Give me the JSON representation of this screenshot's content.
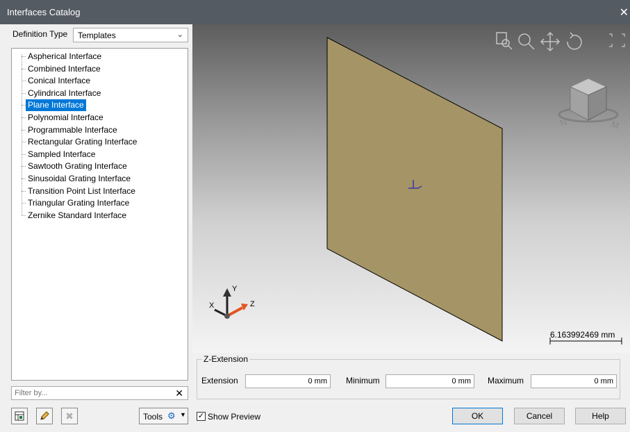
{
  "window": {
    "title": "Interfaces Catalog",
    "close_glyph": "✕"
  },
  "definition_type": {
    "label": "Definition Type",
    "value": "Templates"
  },
  "tree": {
    "items": [
      {
        "label": "Aspherical Interface"
      },
      {
        "label": "Combined Interface"
      },
      {
        "label": "Conical Interface"
      },
      {
        "label": "Cylindrical Interface"
      },
      {
        "label": "Plane Interface",
        "selected": true
      },
      {
        "label": "Polynomial Interface"
      },
      {
        "label": "Programmable Interface"
      },
      {
        "label": "Rectangular Grating Interface"
      },
      {
        "label": "Sampled Interface"
      },
      {
        "label": "Sawtooth Grating Interface"
      },
      {
        "label": "Sinusoidal Grating Interface"
      },
      {
        "label": "Transition Point List Interface"
      },
      {
        "label": "Triangular Grating Interface"
      },
      {
        "label": "Zernike Standard Interface"
      }
    ]
  },
  "filter": {
    "placeholder": "Filter by...",
    "clear_glyph": "✕"
  },
  "toolbar": {
    "tools_label": "Tools"
  },
  "preview": {
    "scale_label": "6.163992469 mm",
    "axis_x": "X",
    "axis_y": "Y",
    "axis_z": "Z",
    "plane_color": "#a59465",
    "icons": [
      "zoom-window-icon",
      "zoom-icon",
      "pan-icon",
      "rotate-icon",
      "fit-view-icon",
      "view-cube-icon"
    ]
  },
  "z_extension": {
    "title": "Z-Extension",
    "extension": {
      "label": "Extension",
      "value": "0 mm"
    },
    "minimum": {
      "label": "Minimum",
      "value": "0 mm"
    },
    "maximum": {
      "label": "Maximum",
      "value": "0 mm"
    }
  },
  "show_preview": {
    "label": "Show Preview",
    "checked": true
  },
  "buttons": {
    "ok": "OK",
    "cancel": "Cancel",
    "help": "Help"
  }
}
